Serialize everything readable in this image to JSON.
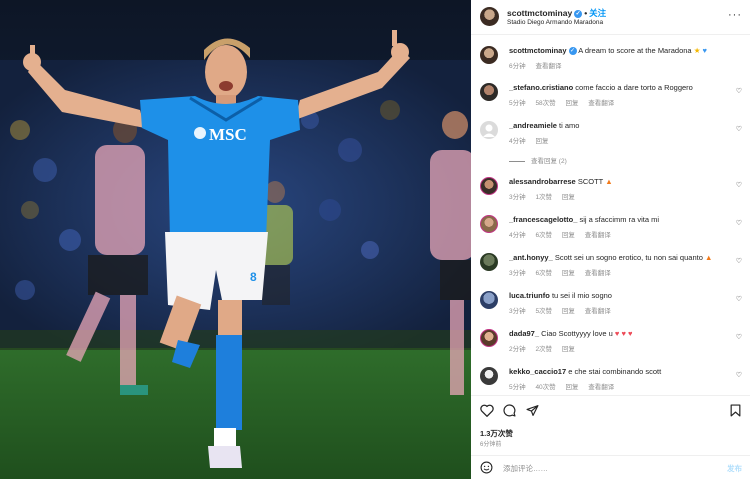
{
  "post": {
    "username": "scottmctominay",
    "follow_label": "关注",
    "location": "Stadio Diego Armando Maradona",
    "caption": "A dream to score at the Maradona",
    "caption_time": "6分钟",
    "see_translation": "查看翻译",
    "image_alt_sponsor": "MSC",
    "image_alt_number": "8"
  },
  "comments": [
    {
      "user": "_stefano.cristiano",
      "text": "come faccio a dare torto a Roggero",
      "time": "5分钟",
      "likes": "58次赞",
      "reply": "回复",
      "translate": "查看翻译"
    },
    {
      "user": "_andreamiele",
      "text": "ti amo",
      "time": "4分钟",
      "reply": "回复",
      "view_replies": "查看回复 (2)"
    },
    {
      "user": "alessandrobarrese",
      "text": "SCOTT",
      "time": "3分钟",
      "likes": "1次赞",
      "reply": "回复"
    },
    {
      "user": "_francescagelotto_",
      "text": "sij a sfaccimm ra vita mi",
      "time": "4分钟",
      "likes": "6次赞",
      "reply": "回复",
      "translate": "查看翻译"
    },
    {
      "user": "_ant.honyy_",
      "text": "Scott sei un sogno erotico, tu non sai quanto",
      "time": "3分钟",
      "likes": "6次赞",
      "reply": "回复",
      "translate": "查看翻译"
    },
    {
      "user": "luca.triunfo",
      "text": "tu sei il mio sogno",
      "time": "3分钟",
      "likes": "5次赞",
      "reply": "回复",
      "translate": "查看翻译"
    },
    {
      "user": "dada97_",
      "text": "Ciao Scottyyyy love u",
      "time": "2分钟",
      "likes": "2次赞",
      "reply": "回复"
    },
    {
      "user": "kekko_caccio17",
      "text": "e che stai combinando scott",
      "time": "5分钟",
      "likes": "40次赞",
      "reply": "回复",
      "translate": "查看翻译"
    }
  ],
  "footer": {
    "likes": "1.3万次赞",
    "time": "6分钟前",
    "add_comment_placeholder": "添加评论……",
    "post_label": "发布"
  },
  "icons": {
    "heart": "heart-icon",
    "comment": "comment-icon",
    "share": "share-icon",
    "save": "bookmark-icon",
    "emoji": "emoji-icon",
    "more": "more-icon"
  },
  "colors": {
    "accent": "#0095f6",
    "verified": "#3897f0",
    "meta_gray": "#8e8e8e",
    "heart_red": "#ed4956",
    "kit_blue": "#1e90e8"
  }
}
